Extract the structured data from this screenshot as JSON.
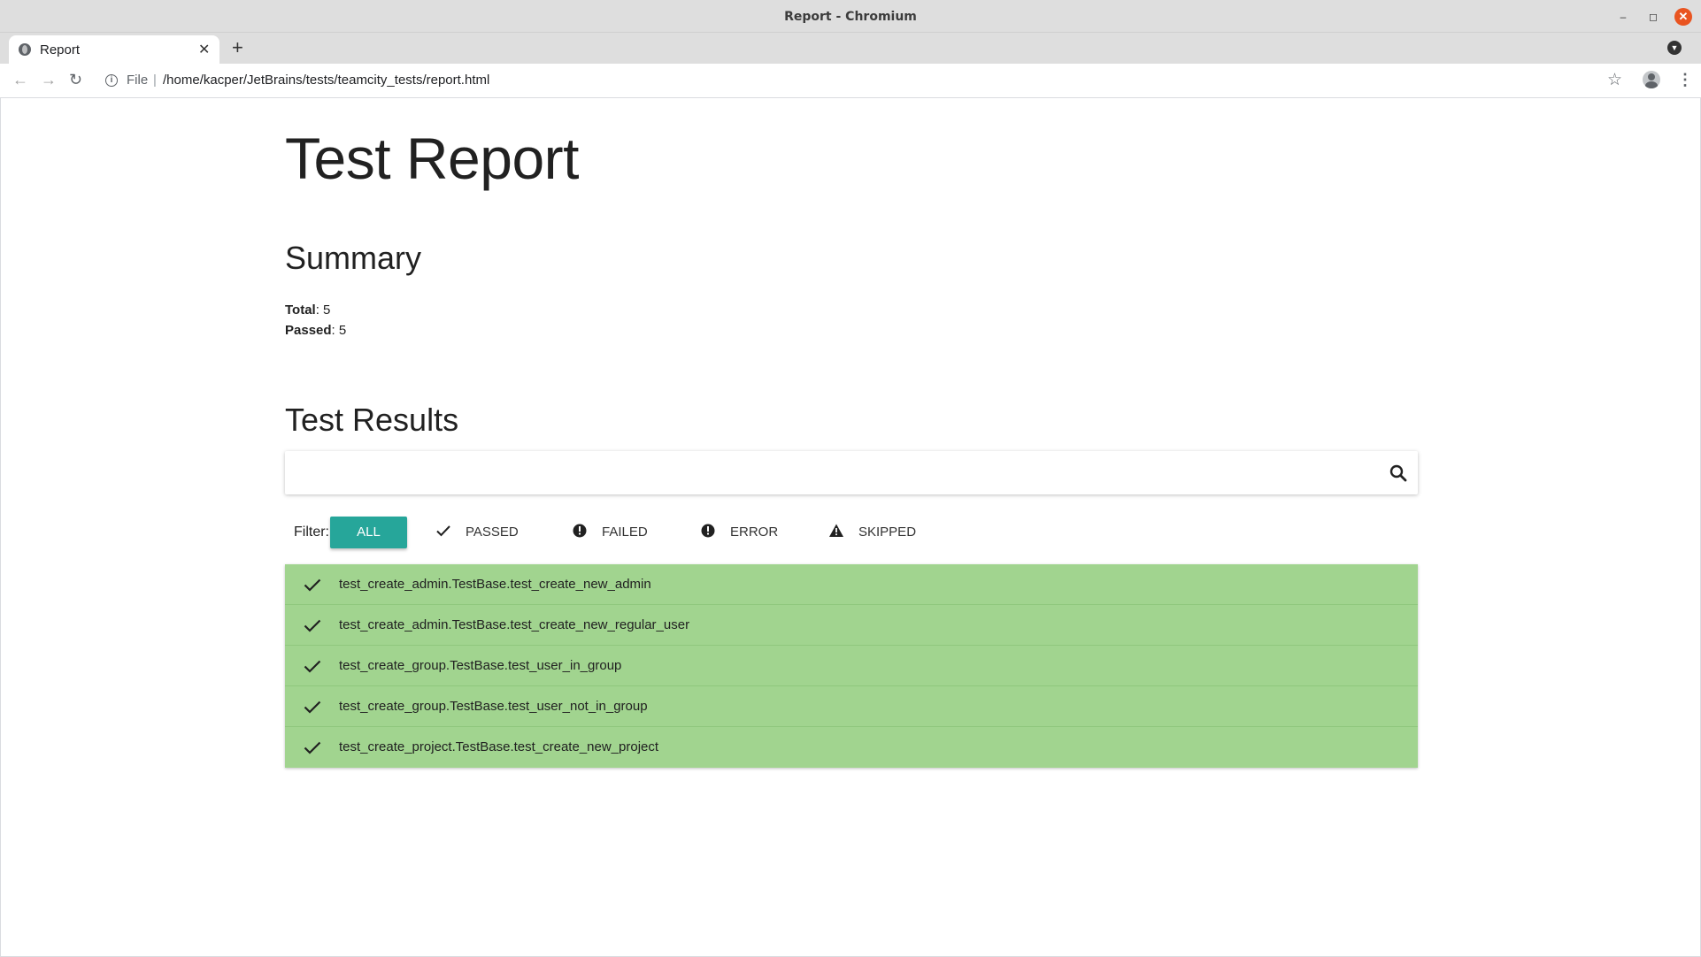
{
  "window": {
    "title": "Report - Chromium",
    "minimize_glyph": "–",
    "maximize_glyph": "◻",
    "close_glyph": "✕"
  },
  "tabs": [
    {
      "label": "Report",
      "favicon": "globe-icon",
      "close_glyph": "✕"
    }
  ],
  "tabstrip": {
    "new_tab_glyph": "+",
    "menu_glyph": "▼"
  },
  "toolbar": {
    "back_glyph": "←",
    "forward_glyph": "→",
    "reload_glyph": "↻",
    "info_glyph": "i",
    "scheme": "File",
    "separator": "|",
    "url": "/home/kacper/JetBrains/tests/teamcity_tests/report.html",
    "star_glyph": "☆",
    "menu_glyph": "⋮"
  },
  "page": {
    "title": "Test Report",
    "summary": {
      "heading": "Summary",
      "total_label": "Total",
      "total_value": ": 5",
      "passed_label": "Passed",
      "passed_value": ": 5"
    },
    "results": {
      "heading": "Test Results",
      "search": {
        "placeholder": "",
        "value": ""
      },
      "filter": {
        "label": "Filter:",
        "options": [
          {
            "label": "ALL",
            "active": true
          },
          {
            "label": "PASSED",
            "icon": "check-icon"
          },
          {
            "label": "FAILED",
            "icon": "error-circle-icon"
          },
          {
            "label": "ERROR",
            "icon": "error-circle-icon"
          },
          {
            "label": "SKIPPED",
            "icon": "warning-triangle-icon"
          }
        ]
      },
      "rows": [
        {
          "name": "test_create_admin.TestBase.test_create_new_admin",
          "status": "passed"
        },
        {
          "name": "test_create_admin.TestBase.test_create_new_regular_user",
          "status": "passed"
        },
        {
          "name": "test_create_group.TestBase.test_user_in_group",
          "status": "passed"
        },
        {
          "name": "test_create_group.TestBase.test_user_not_in_group",
          "status": "passed"
        },
        {
          "name": "test_create_project.TestBase.test_create_new_project",
          "status": "passed"
        }
      ]
    }
  },
  "colors": {
    "accent": "#26a69a",
    "passed_row": "#a1d48f",
    "close_button": "#e95420"
  }
}
